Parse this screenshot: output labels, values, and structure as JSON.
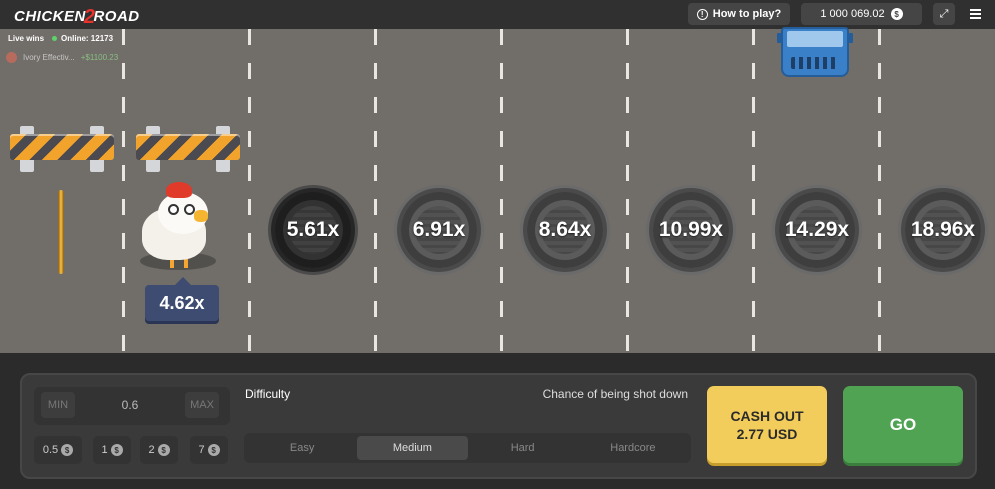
{
  "header": {
    "logo_text_left": "CHICKEN",
    "logo_text_mid": "2",
    "logo_text_right": "ROAD",
    "how_to_play": "How to play?",
    "balance": "1 000 069.02",
    "currency_symbol": "$"
  },
  "live": {
    "label": "Live wins",
    "online": "Online: 12173",
    "feed_user": "Ivory Effectiv...",
    "feed_amount": "+$1100.23"
  },
  "game": {
    "current_multiplier": "4.62x",
    "lanes": [
      "5.61x",
      "6.91x",
      "8.64x",
      "10.99x",
      "14.29x",
      "18.96x"
    ]
  },
  "controls": {
    "min_label": "MIN",
    "max_label": "MAX",
    "bet_value": "0.6",
    "chips": [
      "0.5",
      "1",
      "2",
      "7"
    ],
    "difficulty_label": "Difficulty",
    "chance_label": "Chance of being shot down",
    "difficulties": [
      "Easy",
      "Medium",
      "Hard",
      "Hardcore"
    ],
    "selected_difficulty": "Medium",
    "cashout_line1": "CASH OUT",
    "cashout_line2": "2.77 USD",
    "go_label": "GO"
  },
  "colors": {
    "road": "#716d69",
    "cashout": "#f3cd5b",
    "go": "#4fa352",
    "tag": "#3e4c71"
  }
}
